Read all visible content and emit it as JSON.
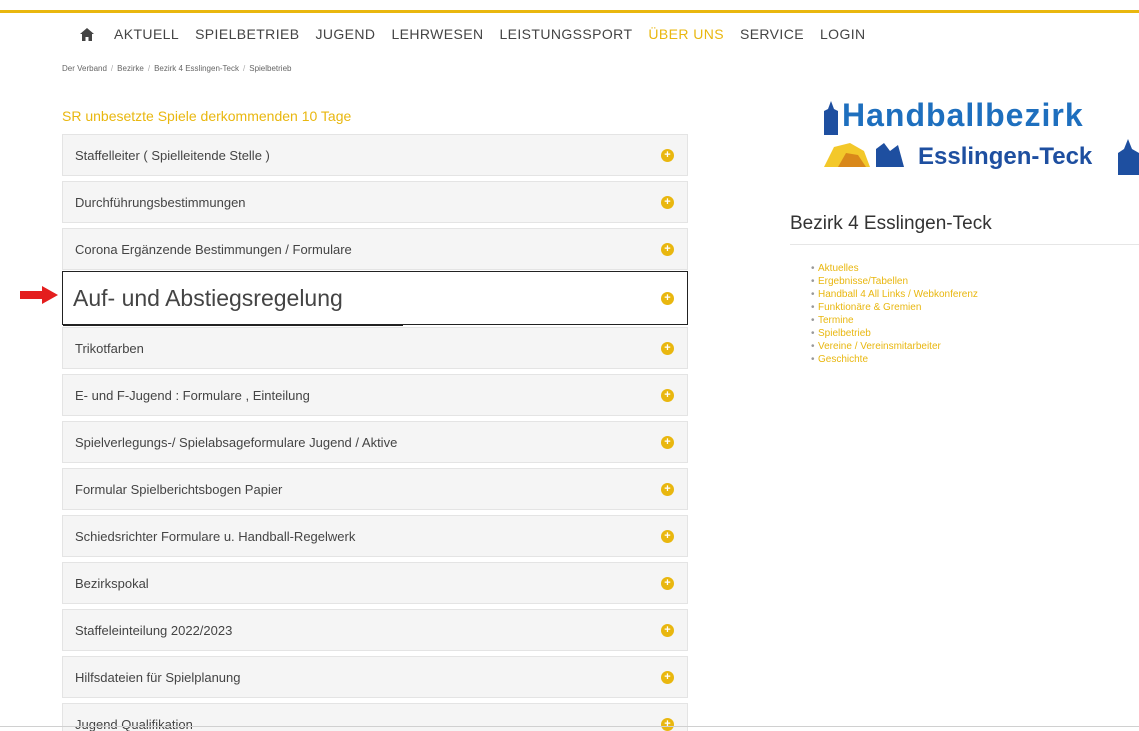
{
  "nav": {
    "items": [
      "AKTUELL",
      "SPIELBETRIEB",
      "JUGEND",
      "LEHRWESEN",
      "LEISTUNGSSPORT",
      "ÜBER UNS",
      "SERVICE",
      "LOGIN"
    ],
    "active": "ÜBER UNS"
  },
  "breadcrumb": [
    "Der Verband",
    "Bezirke",
    "Bezirk 4 Esslingen-Teck",
    "Spielbetrieb"
  ],
  "section_title": "SR unbesetzte Spiele derkommenden 10 Tage",
  "accordion": [
    "Staffelleiter ( Spielleitende Stelle )",
    "Durchführungsbestimmungen",
    "Corona Ergänzende Bestimmungen / Formulare",
    "Auf- und Abstiegsregelung",
    "Trikotfarben",
    "E- und F-Jugend : Formulare , Einteilung",
    "Spielverlegungs-/ Spielabsageformulare Jugend / Aktive",
    "Formular Spielberichtsbogen Papier",
    "Schiedsrichter Formulare u. Handball-Regelwerk",
    "Bezirkspokal",
    "Staffeleinteilung 2022/2023",
    "Hilfsdateien für Spielplanung",
    "Jugend Qualifikation"
  ],
  "logo": {
    "line1": "Handballbezirk",
    "line2": "Esslingen-Teck"
  },
  "sidebar": {
    "title": "Bezirk 4 Esslingen-Teck",
    "links": [
      "Aktuelles",
      "Ergebnisse/Tabellen",
      "Handball 4 All Links / Webkonferenz",
      "Funktionäre & Gremien",
      "Termine",
      "Spielbetrieb",
      "Vereine / Vereinsmitarbeiter",
      "Geschichte"
    ]
  },
  "colors": {
    "accent": "#e9b70f",
    "logo_blue": "#1e6fbe",
    "arrow": "#e41e1e"
  }
}
